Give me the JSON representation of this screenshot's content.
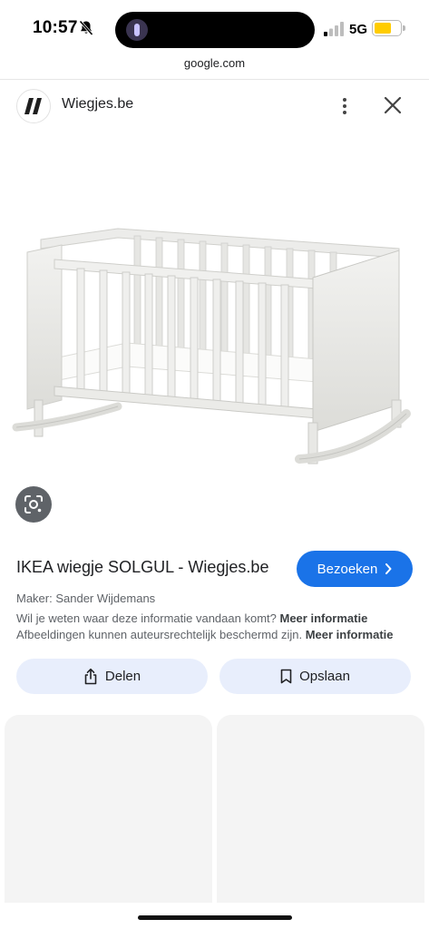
{
  "status": {
    "time": "10:57",
    "network": "5G",
    "battery_color": "#ffcc00"
  },
  "browser": {
    "url": "google.com"
  },
  "site": {
    "name": "Wiegjes.be",
    "logo_icon": "double-slash-logo",
    "more_icon": "more-vert-icon",
    "close_icon": "close-icon"
  },
  "result": {
    "title": "IKEA wiegje SOLGUL - Wiegjes.be",
    "visit_label": "Bezoeken",
    "maker": "Maker: Sander Wijdemans",
    "info_question": "Wil je weten waar deze informatie vandaan komt?",
    "info_link": "Meer informatie",
    "copyright_text": "Afbeeldingen kunnen auteursrechtelijk beschermd zijn.",
    "copyright_link": "Meer informatie",
    "accent_color": "#1a73e8"
  },
  "actions": {
    "share_label": "Delen",
    "save_label": "Opslaan"
  }
}
